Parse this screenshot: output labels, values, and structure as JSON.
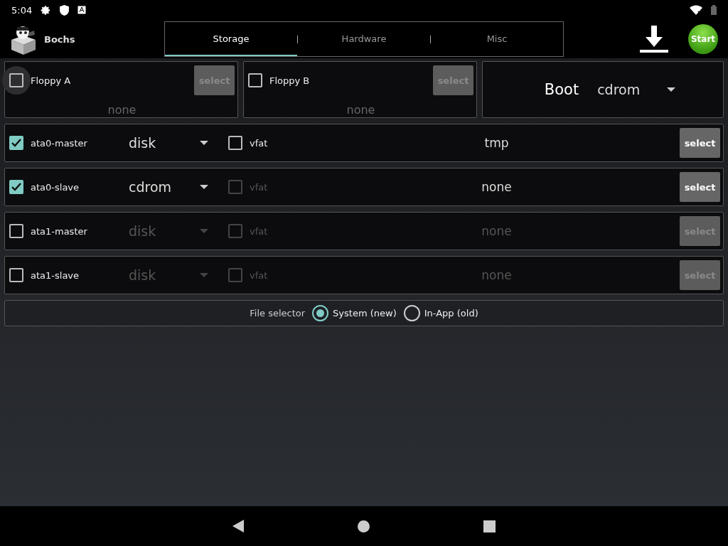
{
  "status_bar": {
    "time": "5:04"
  },
  "app": {
    "title": "Bochs"
  },
  "tabs": [
    {
      "label": "Storage",
      "selected": true
    },
    {
      "label": "Hardware",
      "selected": false
    },
    {
      "label": "Misc",
      "selected": false
    }
  ],
  "actions": {
    "start": "Start"
  },
  "floppies": [
    {
      "label": "Floppy A",
      "checked": false,
      "focused": true,
      "button": {
        "label": "select",
        "disabled": true
      },
      "path": {
        "text": "none",
        "disabled": true
      }
    },
    {
      "label": "Floppy B",
      "checked": false,
      "focused": false,
      "button": {
        "label": "select",
        "disabled": true
      },
      "path": {
        "text": "none",
        "disabled": true
      }
    }
  ],
  "boot": {
    "label": "Boot",
    "value": "cdrom"
  },
  "drives": [
    {
      "label": "ata0-master",
      "checked": true,
      "type": {
        "value": "disk",
        "disabled": false
      },
      "vfat": {
        "label": "vfat",
        "checked": false,
        "disabled": false
      },
      "path": {
        "text": "tmp",
        "disabled": false
      },
      "button": {
        "label": "select",
        "disabled": false
      }
    },
    {
      "label": "ata0-slave",
      "checked": true,
      "type": {
        "value": "cdrom",
        "disabled": false
      },
      "vfat": {
        "label": "vfat",
        "checked": false,
        "disabled": true
      },
      "path": {
        "text": "none",
        "disabled": false
      },
      "button": {
        "label": "select",
        "disabled": false
      }
    },
    {
      "label": "ata1-master",
      "checked": false,
      "type": {
        "value": "disk",
        "disabled": true
      },
      "vfat": {
        "label": "vfat",
        "checked": false,
        "disabled": true
      },
      "path": {
        "text": "none",
        "disabled": true
      },
      "button": {
        "label": "select",
        "disabled": true
      }
    },
    {
      "label": "ata1-slave",
      "checked": false,
      "type": {
        "value": "disk",
        "disabled": true
      },
      "vfat": {
        "label": "vfat",
        "checked": false,
        "disabled": true
      },
      "path": {
        "text": "none",
        "disabled": true
      },
      "button": {
        "label": "select",
        "disabled": true
      }
    }
  ],
  "file_selector": {
    "label": "File selector",
    "options": [
      {
        "label": "System (new)",
        "selected": true
      },
      {
        "label": "In-App (old)",
        "selected": false
      }
    ]
  }
}
